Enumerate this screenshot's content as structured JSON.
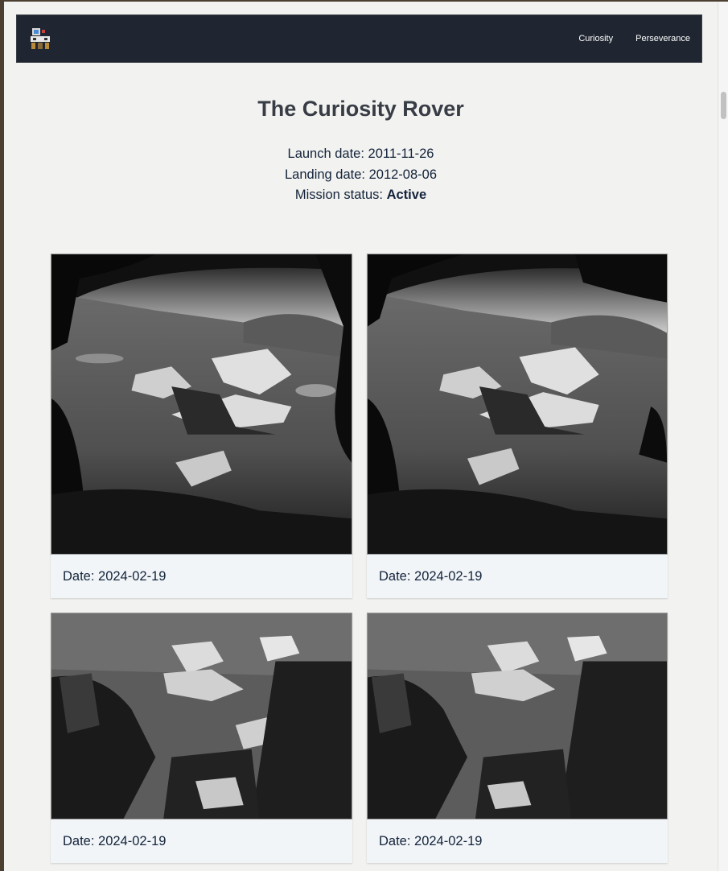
{
  "nav": {
    "logo": "rover-logo-icon",
    "links": [
      "Curiosity",
      "Perseverance"
    ]
  },
  "rover": {
    "title": "The Curiosity Rover",
    "launch_label": "Launch date: ",
    "launch_date": "2011-11-26",
    "landing_label": "Landing date: ",
    "landing_date": "2012-08-06",
    "status_label": "Mission status: ",
    "status": "Active"
  },
  "photos": [
    {
      "caption": "Date: 2024-02-19"
    },
    {
      "caption": "Date: 2024-02-19"
    },
    {
      "caption": "Date: 2024-02-19"
    },
    {
      "caption": "Date: 2024-02-19"
    }
  ],
  "colors": {
    "navbar": "#1f2631",
    "page": "#f2f2f0",
    "card": "#f1f5f8",
    "text": "#13233a"
  }
}
